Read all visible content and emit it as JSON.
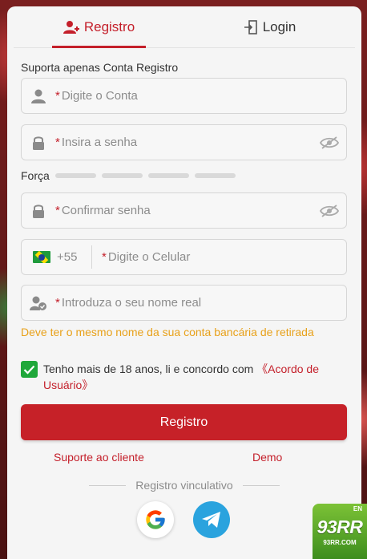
{
  "tabs": {
    "register": "Registro",
    "login": "Login"
  },
  "form": {
    "hint": "Suporta apenas Conta Registro",
    "account_placeholder": "Digite o Conta",
    "password_placeholder": "Insira a senha",
    "strength_label": "Força",
    "confirm_placeholder": "Confirmar senha",
    "country_code": "+55",
    "phone_placeholder": "Digite o Celular",
    "name_placeholder": "Introduza o seu nome real",
    "required_mark": "*",
    "name_warning": "Deve ter o mesmo nome da sua conta bancária de retirada",
    "agree_text": "Tenho mais de 18 anos, li e concordo com ",
    "agree_link": "《Acordo de Usuário》",
    "agree_checked": true,
    "submit": "Registro"
  },
  "links": {
    "support": "Suporte ao cliente",
    "demo": "Demo"
  },
  "social": {
    "divider_label": "Registro vinculativo"
  },
  "badge": {
    "brand": "93RR",
    "domain": "93RR.COM",
    "corner": "EN"
  },
  "colors": {
    "accent": "#c41f2a",
    "warning": "#e8a11a",
    "check": "#1fa83a",
    "telegram": "#2aa3de"
  }
}
